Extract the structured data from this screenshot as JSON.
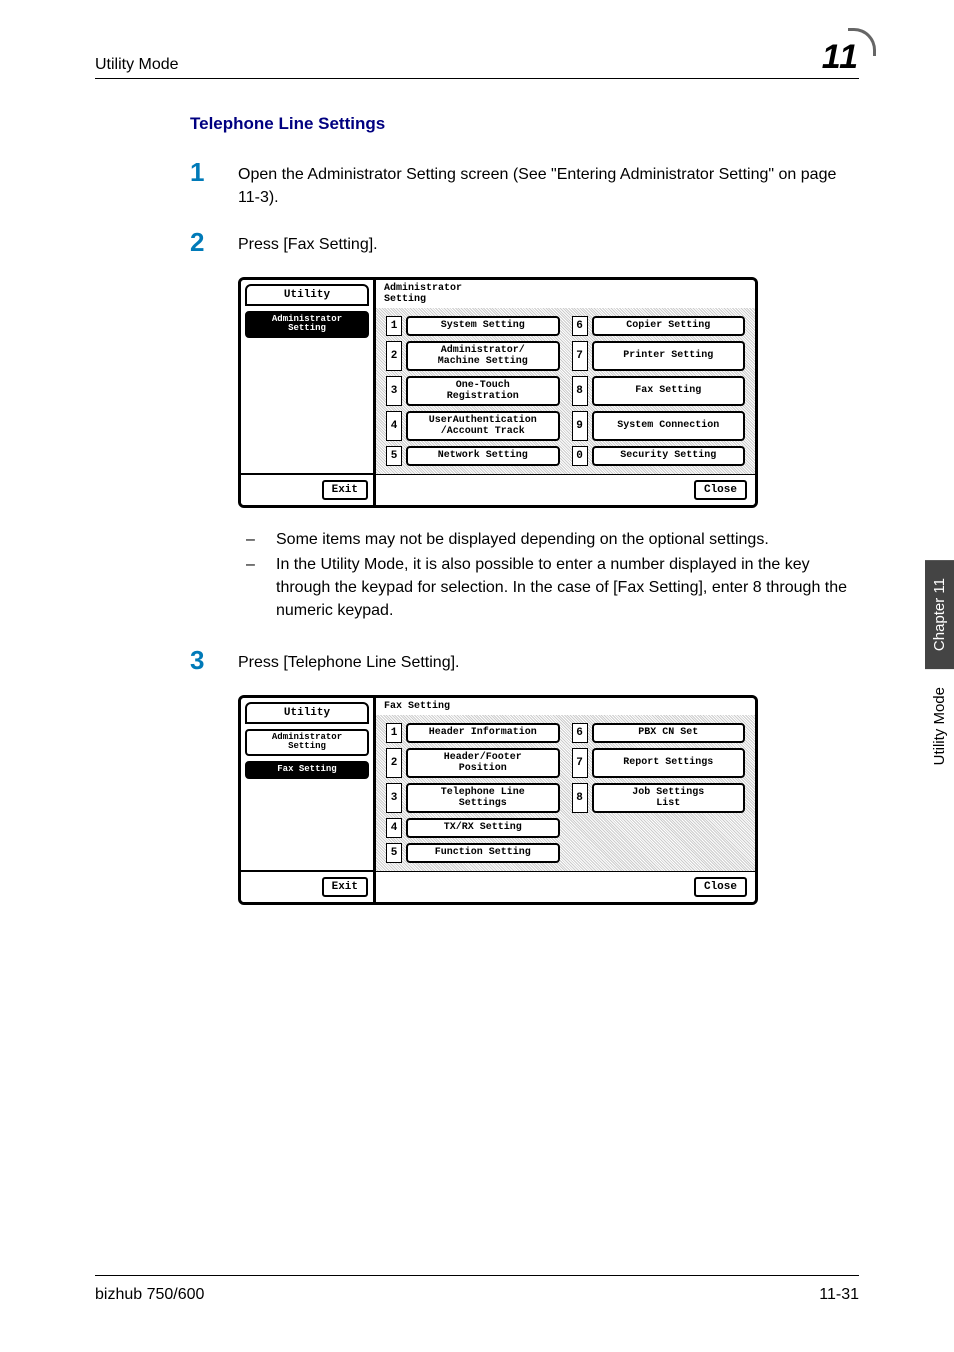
{
  "header": {
    "left": "Utility Mode",
    "right": "11"
  },
  "section_title": "Telephone Line Settings",
  "steps": {
    "s1": {
      "num": "1",
      "text": "Open the Administrator Setting screen (See \"Entering Administrator Setting\" on page 11-3)."
    },
    "s2": {
      "num": "2",
      "text": "Press [Fax Setting]."
    },
    "s3": {
      "num": "3",
      "text": "Press [Telephone Line Setting]."
    }
  },
  "lcd1": {
    "left_tabs": {
      "t1": "Utility",
      "t2": "Administrator\nSetting"
    },
    "header": "Administrator\nSetting",
    "items": [
      {
        "n": "1",
        "label": "System Setting"
      },
      {
        "n": "6",
        "label": "Copier Setting"
      },
      {
        "n": "2",
        "label": "Administrator/\nMachine Setting"
      },
      {
        "n": "7",
        "label": "Printer Setting"
      },
      {
        "n": "3",
        "label": "One-Touch\nRegistration"
      },
      {
        "n": "8",
        "label": "Fax Setting"
      },
      {
        "n": "4",
        "label": "UserAuthentication\n/Account Track"
      },
      {
        "n": "9",
        "label": "System Connection"
      },
      {
        "n": "5",
        "label": "Network Setting"
      },
      {
        "n": "0",
        "label": "Security Setting"
      }
    ],
    "exit": "Exit",
    "close": "Close"
  },
  "lcd2": {
    "left_tabs": {
      "t1": "Utility",
      "t2": "Administrator\nSetting",
      "t3": "Fax Setting"
    },
    "header": "Fax Setting",
    "items": [
      {
        "n": "1",
        "label": "Header Information"
      },
      {
        "n": "6",
        "label": "PBX CN Set"
      },
      {
        "n": "2",
        "label": "Header/Footer\nPosition"
      },
      {
        "n": "7",
        "label": "Report Settings"
      },
      {
        "n": "3",
        "label": "Telephone Line\nSettings"
      },
      {
        "n": "8",
        "label": "Job Settings\nList"
      },
      {
        "n": "4",
        "label": "TX/RX Setting"
      },
      {
        "n": "",
        "label": ""
      },
      {
        "n": "5",
        "label": "Function Setting"
      },
      {
        "n": "",
        "label": ""
      }
    ],
    "exit": "Exit",
    "close": "Close"
  },
  "bullets": {
    "b1": "Some items may not be displayed depending on the optional settings.",
    "b2": "In the Utility Mode, it is also possible to enter a number displayed in the key through the keypad for selection. In the case of [Fax Setting], enter 8 through the numeric keypad."
  },
  "sidetab": {
    "dark": "Chapter 11",
    "light": "Utility Mode"
  },
  "footer": {
    "left": "bizhub 750/600",
    "right": "11-31"
  }
}
